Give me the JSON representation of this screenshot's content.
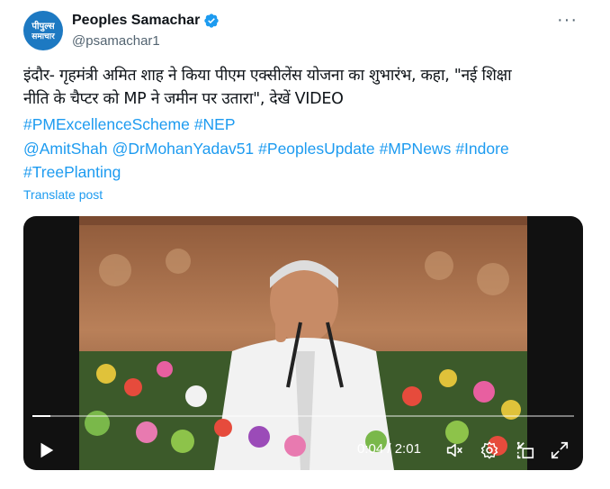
{
  "post": {
    "display_name": "Peoples Samachar",
    "handle": "@psamachar1",
    "avatar_line1": "पीपुल्स",
    "avatar_line2": "समाचार",
    "more_label": "···",
    "text_line1": "इंदौर- गृहमंत्री अमित शाह ने किया पीएम एक्सीलेंस योजना का शुभारंभ, कहा,  \"नई शिक्षा",
    "text_line2": "नीति के चैप्टर को MP ने जमीन पर उतारा\", देखें VIDEO",
    "hashtags_line1": [
      "#PMExcellenceScheme",
      "#NEP"
    ],
    "mentions_line": [
      "@AmitShah",
      "@DrMohanYadav51",
      "#PeoplesUpdate",
      "#MPNews",
      "#Indore"
    ],
    "hashtags_line3": [
      "#TreePlanting"
    ],
    "translate_label": "Translate post"
  },
  "video": {
    "current_time": "0:04",
    "separator": " / ",
    "duration": "2:01",
    "progress": 0.033,
    "icons": [
      "play-icon",
      "mute-icon",
      "settings-icon",
      "picture-in-picture-icon",
      "fullscreen-icon"
    ]
  },
  "colors": {
    "link": "#1d9bf0",
    "verified": "#1d9bf0",
    "secondary_text": "#536471"
  }
}
